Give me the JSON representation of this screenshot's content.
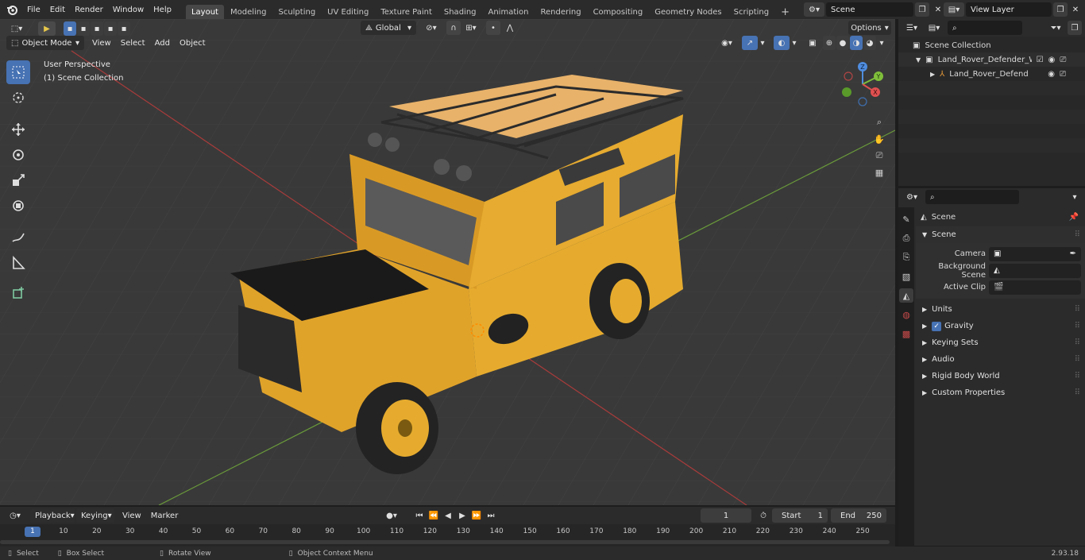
{
  "topbar": {
    "menus": [
      "File",
      "Edit",
      "Render",
      "Window",
      "Help"
    ],
    "workspaces": [
      "Layout",
      "Modeling",
      "Sculpting",
      "UV Editing",
      "Texture Paint",
      "Shading",
      "Animation",
      "Rendering",
      "Compositing",
      "Geometry Nodes",
      "Scripting"
    ],
    "active_workspace": "Layout",
    "scene_name": "Scene",
    "view_layer": "View Layer"
  },
  "viewport": {
    "mode": "Object Mode",
    "menus": [
      "View",
      "Select",
      "Add",
      "Object"
    ],
    "transform_orientation": "Global",
    "options_label": "Options",
    "overlay_title": "User Perspective",
    "overlay_subtitle": "(1) Scene Collection",
    "gizmo_axes": {
      "z": "Z",
      "y": "Y",
      "x": "X"
    },
    "accent": "#4772b3"
  },
  "outliner": {
    "root": "Scene Collection",
    "items": [
      {
        "label": "Land_Rover_Defender_Works",
        "level": 1
      },
      {
        "label": "Land_Rover_Defender_W",
        "level": 2
      }
    ]
  },
  "properties": {
    "header": "Scene",
    "section": "Scene",
    "fields": [
      {
        "label": "Camera",
        "value": ""
      },
      {
        "label": "Background Scene",
        "value": ""
      },
      {
        "label": "Active Clip",
        "value": ""
      }
    ],
    "panels": [
      "Units",
      "Gravity",
      "Keying Sets",
      "Audio",
      "Rigid Body World",
      "Custom Properties"
    ]
  },
  "timeline": {
    "menus": [
      "Playback",
      "Keying",
      "View",
      "Marker"
    ],
    "current_frame": "1",
    "start_label": "Start",
    "start_value": "1",
    "end_label": "End",
    "end_value": "250",
    "ruler": [
      "1",
      "10",
      "20",
      "30",
      "40",
      "50",
      "60",
      "70",
      "80",
      "90",
      "100",
      "110",
      "120",
      "130",
      "140",
      "150",
      "160",
      "170",
      "180",
      "190",
      "200",
      "210",
      "220",
      "230",
      "240",
      "250"
    ]
  },
  "statusbar": {
    "select": "Select",
    "box_select": "Box Select",
    "rotate_view": "Rotate View",
    "context_menu": "Object Context Menu",
    "version": "2.93.18"
  }
}
